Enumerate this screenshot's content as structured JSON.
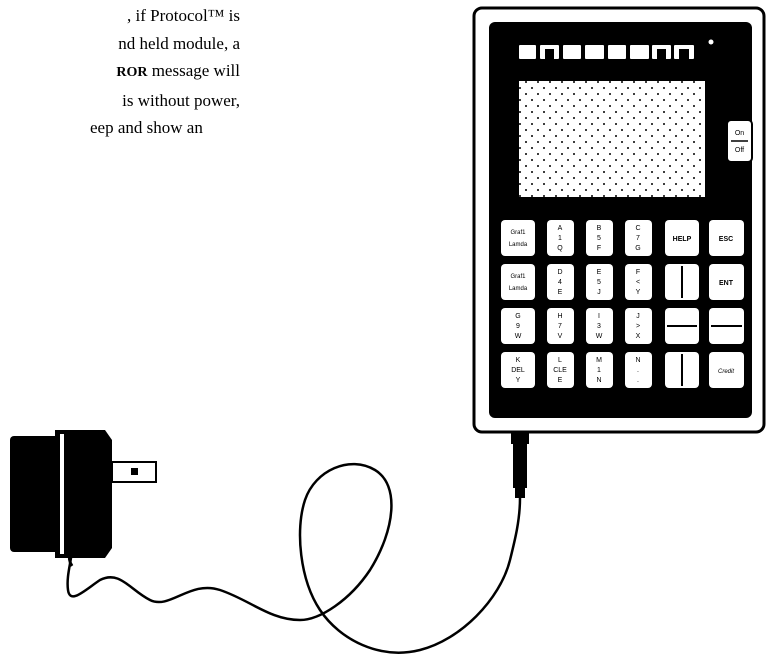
{
  "text": {
    "line1": ", if Protocol™ is",
    "line2": "nd held module, a",
    "line3_bold": "ROR",
    "line3_rest": " message will",
    "line4": " is without power,",
    "line5": "eep and show an"
  },
  "device": {
    "display_segments": "8-segment style display",
    "side_button_top": "On",
    "side_button_bottom": "Off",
    "keys": [
      [
        "Graf1 Lamda",
        "A 1 Q",
        "B 5 F",
        "C 7 G",
        "HELP",
        "ESC"
      ],
      [
        "Graf1 Lamda",
        "D 4 E",
        "E 5 J",
        "F < Y",
        "",
        "ENT"
      ],
      [
        "G 9 W",
        "H 7 V",
        "I 3 W",
        "J > X",
        "",
        ""
      ],
      [
        "K DEL Y",
        "L CLE E",
        "M 1 N",
        "N . .",
        "",
        "Credit"
      ]
    ]
  }
}
